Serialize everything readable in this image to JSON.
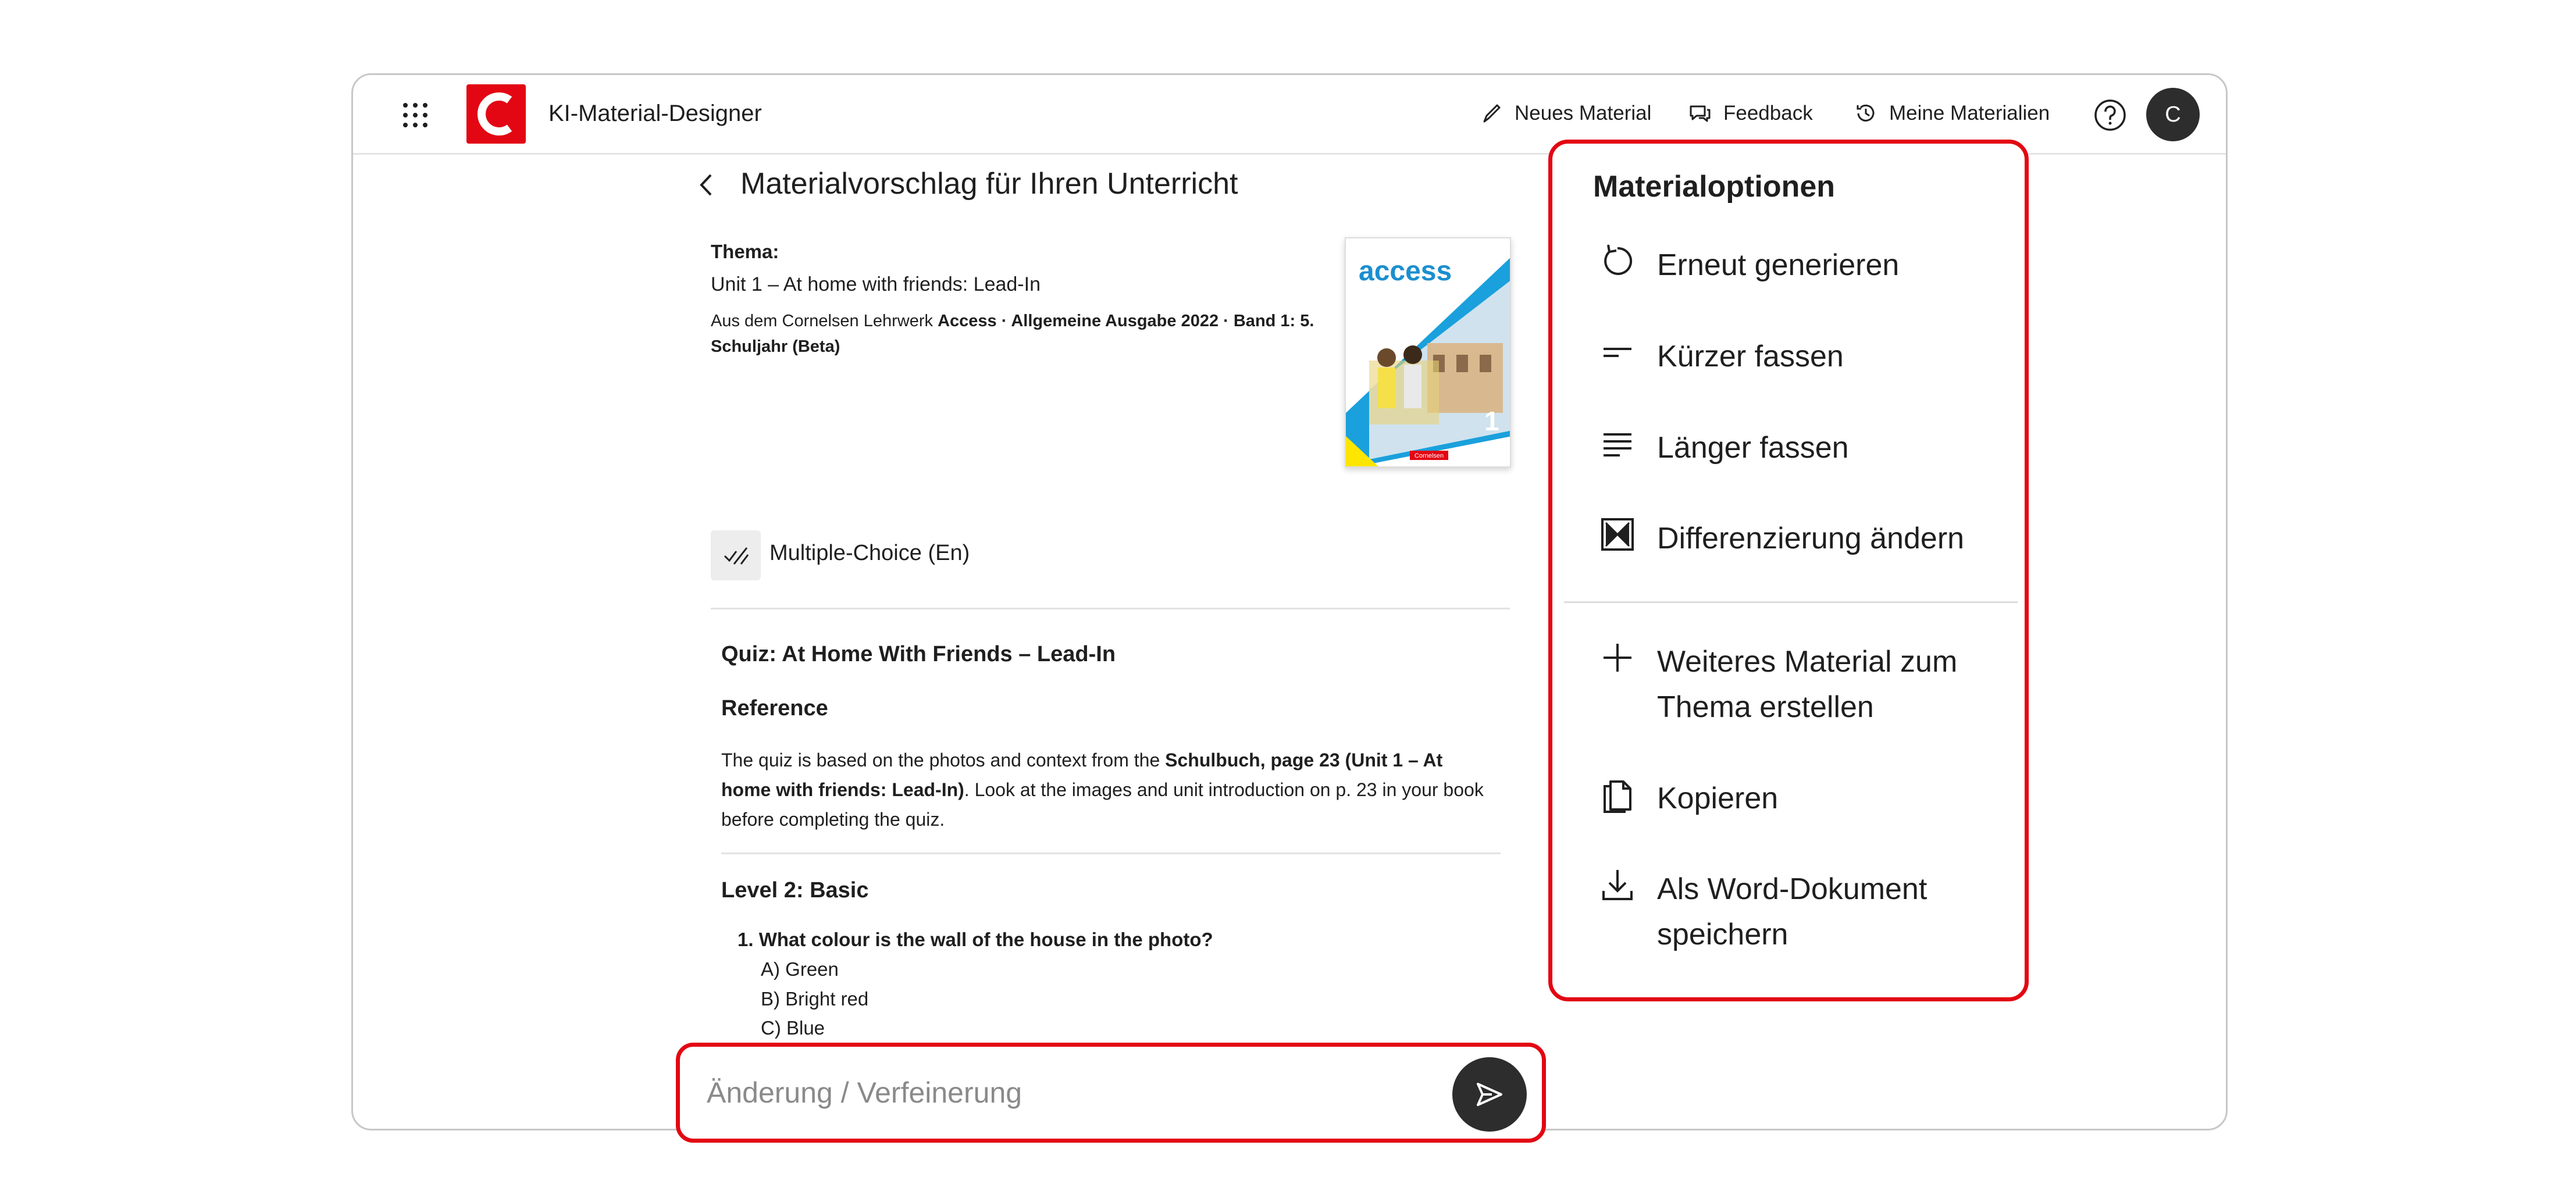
{
  "header": {
    "app_title": "KI-Material-Designer",
    "logo_letter": "C",
    "nav": [
      {
        "label": "Neues Material",
        "icon": "pen-icon"
      },
      {
        "label": "Feedback",
        "icon": "chat-icon"
      },
      {
        "label": "Meine Materialien",
        "icon": "history-icon"
      }
    ],
    "avatar_initial": "C"
  },
  "main": {
    "title": "Materialvorschlag für Ihren Unterricht",
    "thema_label": "Thema:",
    "thema_title": "Unit 1 – At home with friends: Lead-In",
    "source_prefix": "Aus dem Cornelsen Lehrwerk ",
    "source_bold": "Access · Allgemeine Ausgabe 2022 · Band 1: 5. Schuljahr (Beta)",
    "book": {
      "brand": "access",
      "number": "1",
      "publisher": "Cornelsen"
    },
    "material_type": "Multiple-Choice (En)",
    "quiz_title": "Quiz: At Home With Friends – Lead-In",
    "reference_title": "Reference",
    "reference_text_1": "The quiz is based on the photos and context from the ",
    "reference_bold": "Schulbuch, page 23 (Unit 1 – At home with friends: Lead-In)",
    "reference_text_2": ". Look at the images and unit introduction on p. 23 in your book before completing the quiz.",
    "level_title": "Level 2: Basic",
    "question": "1. What colour is the wall of the house in the photo?",
    "answers": [
      "A) Green",
      "B) Bright red",
      "C) Blue"
    ]
  },
  "input": {
    "placeholder": "Änderung / Verfeinerung"
  },
  "options": {
    "title": "Materialoptionen",
    "items": [
      {
        "label": "Erneut generieren",
        "icon": "refresh-icon"
      },
      {
        "label": "Kürzer fassen",
        "icon": "short-lines-icon"
      },
      {
        "label": "Länger fassen",
        "icon": "long-lines-icon"
      },
      {
        "label": "Differenzierung ändern",
        "icon": "differentiation-icon"
      },
      {
        "label": "Weiteres Material zum Thema erstellen",
        "icon": "plus-icon"
      },
      {
        "label": "Kopieren",
        "icon": "copy-icon"
      },
      {
        "label": "Als Word-Dokument speichern",
        "icon": "download-icon"
      }
    ]
  },
  "colors": {
    "accent": "#e30613",
    "dark": "#2d2d2d",
    "book_blue": "#1aa0dc"
  }
}
